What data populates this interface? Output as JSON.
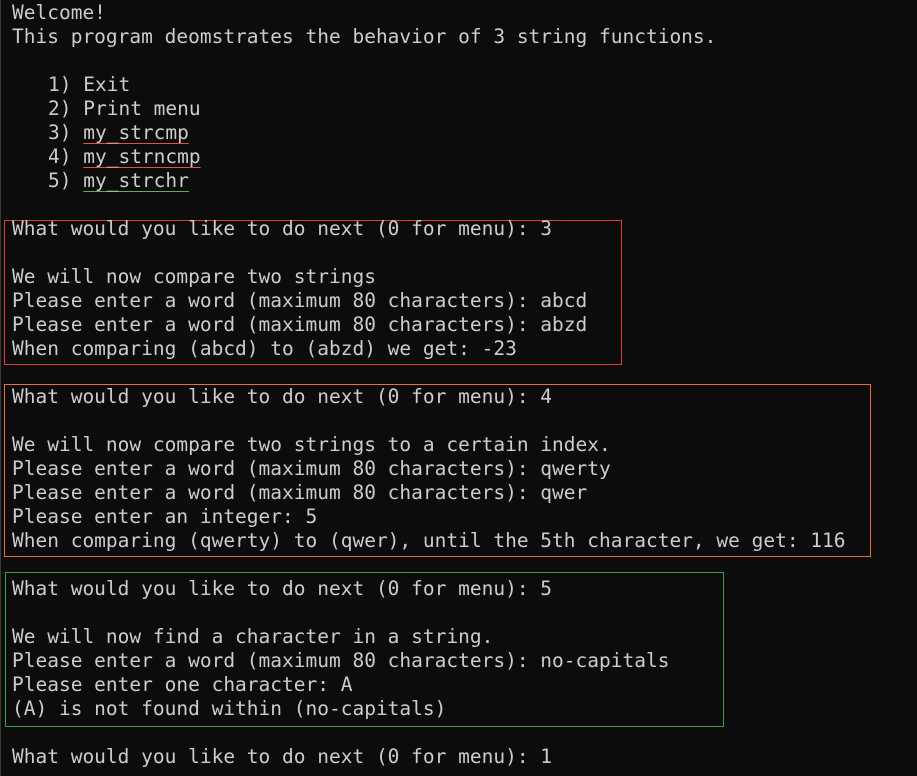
{
  "intro": {
    "welcome": "Welcome!",
    "description": "This program deomstrates the behavior of 3 string functions."
  },
  "menu": [
    {
      "num": "1)",
      "label": "Exit"
    },
    {
      "num": "2)",
      "label": "Print menu"
    },
    {
      "num": "3)",
      "label": "my_strcmp",
      "underline": "#e05050"
    },
    {
      "num": "4)",
      "label": "my_strncmp",
      "underline": "#e05050"
    },
    {
      "num": "5)",
      "label": "my_strchr",
      "underline": "#5ab05a"
    }
  ],
  "sessions": [
    {
      "highlight_color": "#e03a3a",
      "lines": [
        "What would you like to do next (0 for menu): 3",
        "",
        "We will now compare two strings",
        "Please enter a word (maximum 80 characters): abcd",
        "Please enter a word (maximum 80 characters): abzd",
        "When comparing (abcd) to (abzd) we get: -23"
      ]
    },
    {
      "highlight_color": "#e8703a",
      "lines": [
        "What would you like to do next (0 for menu): 4",
        "",
        "We will now compare two strings to a certain index.",
        "Please enter a word (maximum 80 characters): qwerty",
        "Please enter a word (maximum 80 characters): qwer",
        "Please enter an integer: 5",
        "When comparing (qwerty) to (qwer), until the 5th character, we get: 116"
      ]
    },
    {
      "highlight_color": "#3aa04a",
      "lines": [
        "What would you like to do next (0 for menu): 5",
        "",
        "We will now find a character in a string.",
        "Please enter a word (maximum 80 characters): no-capitals",
        "Please enter one character: A",
        "(A) is not found within (no-capitals)"
      ]
    }
  ],
  "final_prompt": "What would you like to do next (0 for menu): 1",
  "colors": {
    "background": "#0c0c0c",
    "foreground": "#cccccc"
  }
}
